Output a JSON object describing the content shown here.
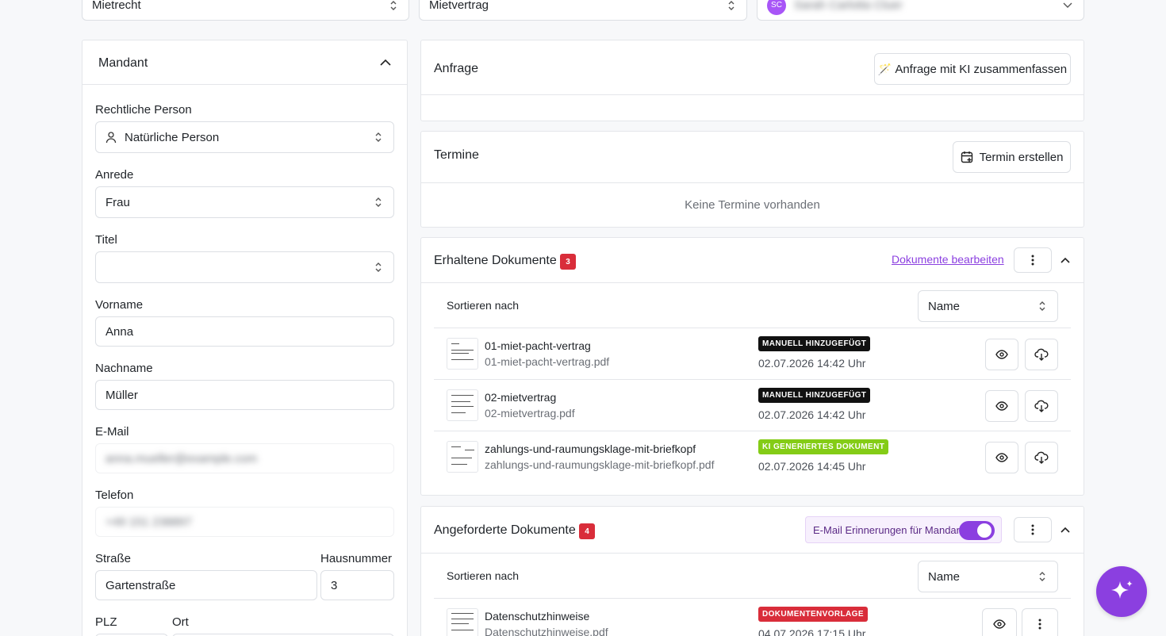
{
  "top": {
    "rechtsgebiet": "Mietrecht",
    "vertragsart": "Mietvertrag",
    "assignee_initials": "SC",
    "assignee_name": "Sarah Carlotta Cluer"
  },
  "mandant": {
    "title": "Mandant",
    "rechtliche_person_label": "Rechtliche Person",
    "rechtliche_person_value": "Natürliche Person",
    "anrede_label": "Anrede",
    "anrede_value": "Frau",
    "titel_label": "Titel",
    "titel_value": "",
    "vorname_label": "Vorname",
    "vorname_value": "Anna",
    "nachname_label": "Nachname",
    "nachname_value": "Müller",
    "email_label": "E-Mail",
    "email_value": "anna.mueller@example.com",
    "telefon_label": "Telefon",
    "telefon_value": "+49 151 238897",
    "strasse_label": "Straße",
    "strasse_value": "Gartenstraße",
    "hausnummer_label": "Hausnummer",
    "hausnummer_value": "3",
    "plz_label": "PLZ",
    "ort_label": "Ort"
  },
  "anfrage": {
    "title": "Anfrage",
    "summarize_label": "Anfrage mit KI zusammenfassen",
    "summarize_icon": "🪄"
  },
  "termine": {
    "title": "Termine",
    "create_label": "Termin erstellen",
    "empty_text": "Keine Termine vorhanden"
  },
  "erhaltene": {
    "title": "Erhaltene Dokumente",
    "count": "3",
    "edit_link": "Dokumente bearbeiten",
    "sort_label": "Sortieren nach",
    "sort_value": "Name",
    "docs": [
      {
        "name": "01-miet-pacht-vertrag",
        "file": "01-miet-pacht-vertrag.pdf",
        "tag": "MANUELL HINZUGEFÜGT",
        "date": "02.07.2026 14:42 Uhr"
      },
      {
        "name": "02-mietvertrag",
        "file": "02-mietvertrag.pdf",
        "tag": "MANUELL HINZUGEFÜGT",
        "date": "02.07.2026 14:42 Uhr"
      },
      {
        "name": "zahlungs-und-raumungsklage-mit-briefkopf",
        "file": "zahlungs-und-raumungsklage-mit-briefkopf.pdf",
        "tag": "KI GENERIERTES DOKUMENT",
        "date": "02.07.2026 14:45 Uhr"
      }
    ]
  },
  "angeforderte": {
    "title": "Angeforderte Dokumente",
    "count": "4",
    "reminder_label": "E-Mail Erinnerungen für Mandant",
    "reminder_on": true,
    "sort_label": "Sortieren nach",
    "sort_value": "Name",
    "docs": [
      {
        "name": "Datenschutzhinweise",
        "file": "Datenschutzhinweise.pdf",
        "tag": "DOKUMENTENVORLAGE",
        "date": "04.07.2026 17:15 Uhr"
      }
    ]
  },
  "colors": {
    "accent": "#8b3fe0",
    "danger": "#d92d3a",
    "green": "#84cc16"
  }
}
